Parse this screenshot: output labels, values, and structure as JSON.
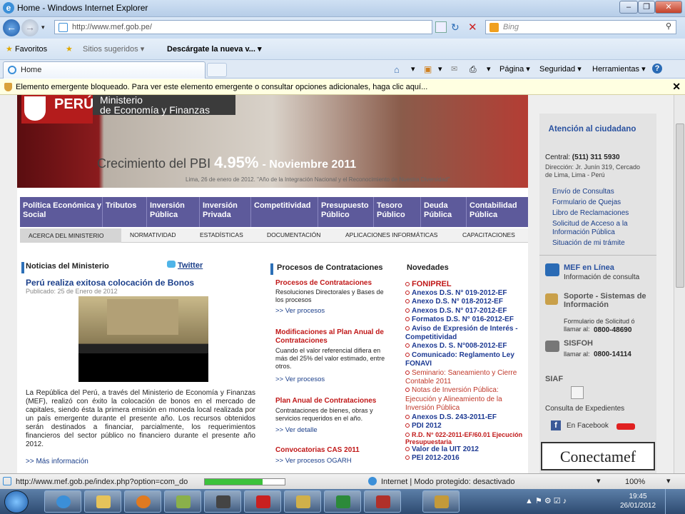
{
  "window": {
    "title": "Home - Windows Internet Explorer"
  },
  "address": {
    "url": "http://www.mef.gob.pe/",
    "search_placeholder": "Bing"
  },
  "favorites": {
    "favoritos": "Favoritos",
    "sitios": "Sitios sugeridos ▾",
    "descargate": "Descárgate la nueva v... ▾"
  },
  "tab": {
    "label": "Home"
  },
  "commandbar": {
    "pagina": "Página ▾",
    "seguridad": "Seguridad ▾",
    "herramientas": "Herramientas ▾"
  },
  "infobar": {
    "text": "Elemento emergente bloqueado. Para ver este elemento emergente o consultar opciones adicionales, haga clic aquí..."
  },
  "banner": {
    "logo": "PERÚ",
    "ministerio_line1": "Ministerio",
    "ministerio_line2": "de Economía y Finanzas",
    "pbi_label": "Crecimiento del PBI",
    "pbi_value": "4.95%",
    "pbi_period": "- Noviembre 2011",
    "fecha": "Lima, 26 de enero de 2012.   \"Año de la Integración Nacional y el Reconocimiento de Nuestra Diversidad\""
  },
  "menu_main": [
    "Política Económica y Social",
    "Tributos",
    "Inversión Pública",
    "Inversión Privada",
    "Competitividad",
    "Presupuesto Público",
    "Tesoro Público",
    "Deuda Pública",
    "Contabilidad Pública"
  ],
  "menu_sub": [
    "ACERCA DEL MINISTERIO",
    "NORMATIVIDAD",
    "ESTADÍSTICAS",
    "DOCUMENTACIÓN",
    "APLICACIONES INFORMÁTICAS",
    "CAPACITACIONES"
  ],
  "noticias": {
    "heading": "Noticias del Ministerio",
    "twitter": "Twitter",
    "title": "Perú realiza exitosa colocación de Bonos",
    "published": "Publicado: 25 de Enero de 2012",
    "body": "La República del Perú, a través del Ministerio de Economía y Finanzas (MEF), realizó con éxito la colocación de bonos en el mercado de capitales, siendo ésta la primera emisión en moneda local realizada por un país emergente durante el presente año. Los recursos obtenidos serán destinados a financiar, parcialmente, los requerimientos financieros del sector público no financiero durante el presente año 2012.",
    "more": ">> Más información"
  },
  "procesos": {
    "heading": "Procesos de Contrataciones",
    "items": [
      {
        "title": "Procesos de Contrataciones",
        "desc": "Resoluciones Directorales y Bases de los procesos",
        "link": ">> Ver  procesos"
      },
      {
        "title": "Modificaciones al Plan Anual de Contrataciones",
        "desc": "Cuando el valor referencial difiera en más del 25% del valor estimado, entre otros.",
        "link": ">> Ver  procesos"
      },
      {
        "title": "Plan Anual de Contrataciones",
        "desc": "Contrataciones de bienes, obras y servicios requeridos en el año.",
        "link": ">> Ver detalle"
      },
      {
        "title": "Convocatorias CAS 2011",
        "desc": "",
        "link": ">> Ver  procesos OGARH"
      }
    ]
  },
  "novedades": {
    "heading": "Novedades",
    "first": "FONIPREL",
    "items": [
      "Anexos D.S.  N° 019-2012-EF",
      "Anexo D.S.  N° 018-2012-EF",
      "Anexos D.S.  N° 017-2012-EF",
      "Formatos D.S.  N° 016-2012-EF",
      "Aviso de Expresión de Interés - Competitividad",
      "Anexos D. S. N°008-2012-EF",
      "Comunicado: Reglamento Ley FONAVI",
      "Seminario: Saneamiento y Cierre Contable 2011",
      "Notas de Inversión Pública: Ejecución y Alineamiento de la Inversión Pública",
      "Anexos D.S. 243-2011-EF",
      "PDI 2012",
      "R.D. N° 022-2011-EF/60.01 Ejecución Presupuestaria",
      "Valor de la UIT 2012",
      "PEI  2012-2016"
    ]
  },
  "atencion": {
    "title": "Atención al ciudadano",
    "central_label": "Central:",
    "central_phone": "(511) 311 5930",
    "direccion": "Dirección: Jr. Junín 319, Cercado de Lima, Lima - Perú",
    "links": [
      "Envío de Consultas",
      "Formulario de Quejas",
      "Libro de Reclamaciones",
      "Solicitud de Acceso a la Información Pública",
      "Situación de mi trámite"
    ]
  },
  "servicios": {
    "mef_title": "MEF en Línea",
    "mef_sub": "Información de consulta",
    "soporte_title": "Soporte - Sistemas de Información",
    "soporte_sub": "Formulario de Solicitud ó llamar al:",
    "soporte_phone": "0800-48690",
    "sisfoh_title": "SISFOH",
    "sisfoh_sub": "llamar al:",
    "sisfoh_phone": "0800-14114",
    "siaf_title": "SIAF",
    "siaf_sub": "Consulta de Expedientes",
    "facebook": "En Facebook",
    "conectamef": "Conectamef"
  },
  "status": {
    "url": "http://www.mef.gob.pe/index.php?option=com_do",
    "progress": 0.72,
    "zone": "Internet | Modo protegido: desactivado",
    "zoom": "100%"
  },
  "taskbar": {
    "time": "19:45",
    "date": "26/01/2012"
  }
}
